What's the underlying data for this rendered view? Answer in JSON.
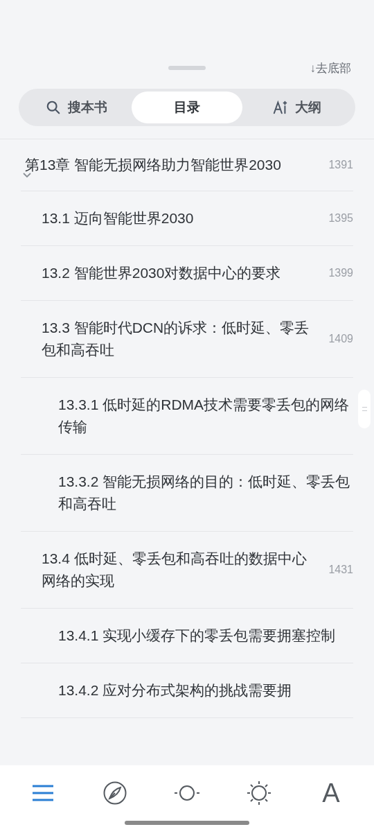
{
  "header": {
    "go_bottom": "↓去底部"
  },
  "tabs": [
    {
      "kind": "search",
      "label": "搜本书",
      "selected": false
    },
    {
      "kind": "plain",
      "label": "目录",
      "selected": true
    },
    {
      "kind": "ai",
      "label": "大纲",
      "selected": false
    }
  ],
  "toc": [
    {
      "title": "第13章 智能无损网络助力智能世界2030",
      "page": "1391",
      "expanded": true,
      "children": [
        {
          "title": "13.1 迈向智能世界2030",
          "page": "1395"
        },
        {
          "title": "13.2 智能世界2030对数据中心的要求",
          "page": "1399"
        },
        {
          "title": "13.3 智能时代DCN的诉求：低时延、零丢包和高吞吐",
          "page": "1409",
          "children": [
            {
              "title": "13.3.1 低时延的RDMA技术需要零丢包的网络传输"
            },
            {
              "title": "13.3.2 智能无损网络的目的：低时延、零丢包和高吞吐"
            }
          ]
        },
        {
          "title": "13.4 低时延、零丢包和高吞吐的数据中心网络的实现",
          "page": "1431",
          "children": [
            {
              "title": "13.4.1 实现小缓存下的零丢包需要拥塞控制"
            },
            {
              "title": "13.4.2 应对分布式架构的挑战需要拥"
            }
          ]
        }
      ]
    }
  ],
  "toolbar": [
    {
      "kind": "menu",
      "selected": true
    },
    {
      "kind": "compass",
      "selected": false
    },
    {
      "kind": "dim",
      "selected": false
    },
    {
      "kind": "brightness",
      "selected": false
    },
    {
      "kind": "font",
      "label": "A",
      "selected": false
    }
  ]
}
